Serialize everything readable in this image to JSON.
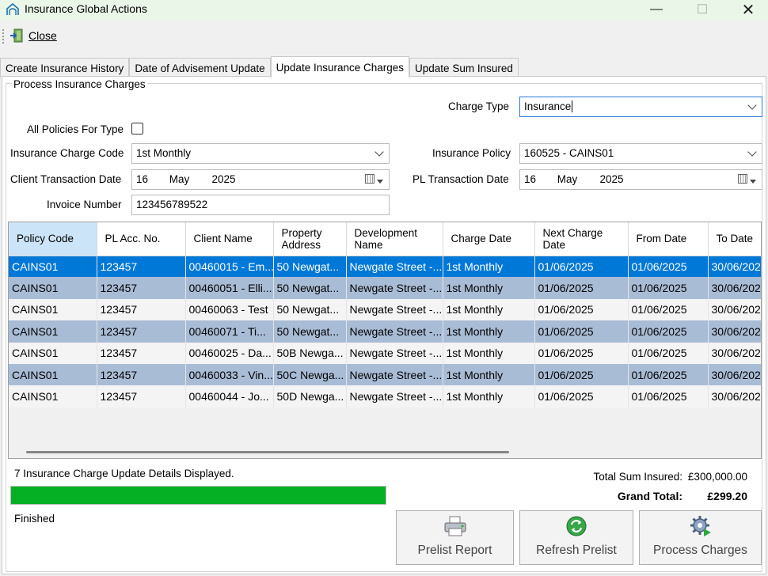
{
  "window": {
    "title": "Insurance Global Actions",
    "min_glyph": "—",
    "max_glyph": "☐",
    "close_glyph": "✕"
  },
  "toolbar": {
    "close_label": "Close"
  },
  "tabs": [
    {
      "label": "Create Insurance History"
    },
    {
      "label": "Date of Advisement Update"
    },
    {
      "label": "Update Insurance Charges",
      "active": true
    },
    {
      "label": "Update Sum Insured"
    }
  ],
  "form": {
    "group_title": "Process Insurance Charges",
    "charge_type_label": "Charge Type",
    "charge_type_value": "Insurance",
    "all_policies_label": "All Policies For Type",
    "charge_code_label": "Insurance Charge Code",
    "charge_code_value": "1st Monthly",
    "policy_label": "Insurance Policy",
    "policy_value": "160525 - CAINS01",
    "client_date_label": "Client Transaction Date",
    "client_date": {
      "day": "16",
      "month": "May",
      "year": "2025"
    },
    "pl_date_label": "PL Transaction Date",
    "pl_date": {
      "day": "16",
      "month": "May",
      "year": "2025"
    },
    "invoice_label": "Invoice Number",
    "invoice_value": "123456789522"
  },
  "grid": {
    "columns": [
      "Policy Code",
      "PL Acc. No.",
      "Client Name",
      "Property Address",
      "Development Name",
      "Charge Date",
      "Next Charge Date",
      "From Date",
      "To Date"
    ],
    "rows": [
      [
        "CAINS01",
        "123457",
        "00460015 - Em...",
        "50 Newgat...",
        "Newgate Street -...",
        "1st Monthly",
        "01/06/2025",
        "01/06/2025",
        "30/06/202"
      ],
      [
        "CAINS01",
        "123457",
        "00460051 - Elli...",
        "50 Newgat...",
        "Newgate Street -...",
        "1st Monthly",
        "01/06/2025",
        "01/06/2025",
        "30/06/202"
      ],
      [
        "CAINS01",
        "123457",
        "00460063 - Test",
        "50 Newgat...",
        "Newgate Street -...",
        "1st Monthly",
        "01/06/2025",
        "01/06/2025",
        "30/06/202"
      ],
      [
        "CAINS01",
        "123457",
        "00460071 - Ti...",
        "50 Newgat...",
        "Newgate Street -...",
        "1st Monthly",
        "01/06/2025",
        "01/06/2025",
        "30/06/202"
      ],
      [
        "CAINS01",
        "123457",
        "00460025 - Da...",
        "50B Newga...",
        "Newgate Street -...",
        "1st Monthly",
        "01/06/2025",
        "01/06/2025",
        "30/06/202"
      ],
      [
        "CAINS01",
        "123457",
        "00460033 - Vin...",
        "50C Newga...",
        "Newgate Street -...",
        "1st Monthly",
        "01/06/2025",
        "01/06/2025",
        "30/06/202"
      ],
      [
        "CAINS01",
        "123457",
        "00460044 - Jo...",
        "50D Newga...",
        "Newgate Street -...",
        "1st Monthly",
        "01/06/2025",
        "01/06/2025",
        "30/06/202"
      ]
    ],
    "selected_row": 0
  },
  "status": {
    "message": "7 Insurance Charge Update Details Displayed.",
    "total_sum_label": "Total Sum Insured:",
    "total_sum_value": "£300,000.00",
    "grand_total_label": "Grand Total:",
    "grand_total_value": "£299.20",
    "progress": 1.0,
    "progress_color": "#06b025",
    "finished_text": "Finished"
  },
  "actions": {
    "prelist_report": "Prelist Report",
    "refresh_prelist": "Refresh Prelist",
    "process_charges": "Process Charges"
  },
  "colors": {
    "selected_row": "#0078d7",
    "alt_row": "#a9bcd6",
    "title_bar": "#eaf6e8"
  },
  "icons": {
    "app": "house-arch-icon",
    "close_tool": "door-exit-icon",
    "prelist": "printer-icon",
    "refresh": "refresh-arrows-icon",
    "process": "gear-play-icon"
  }
}
